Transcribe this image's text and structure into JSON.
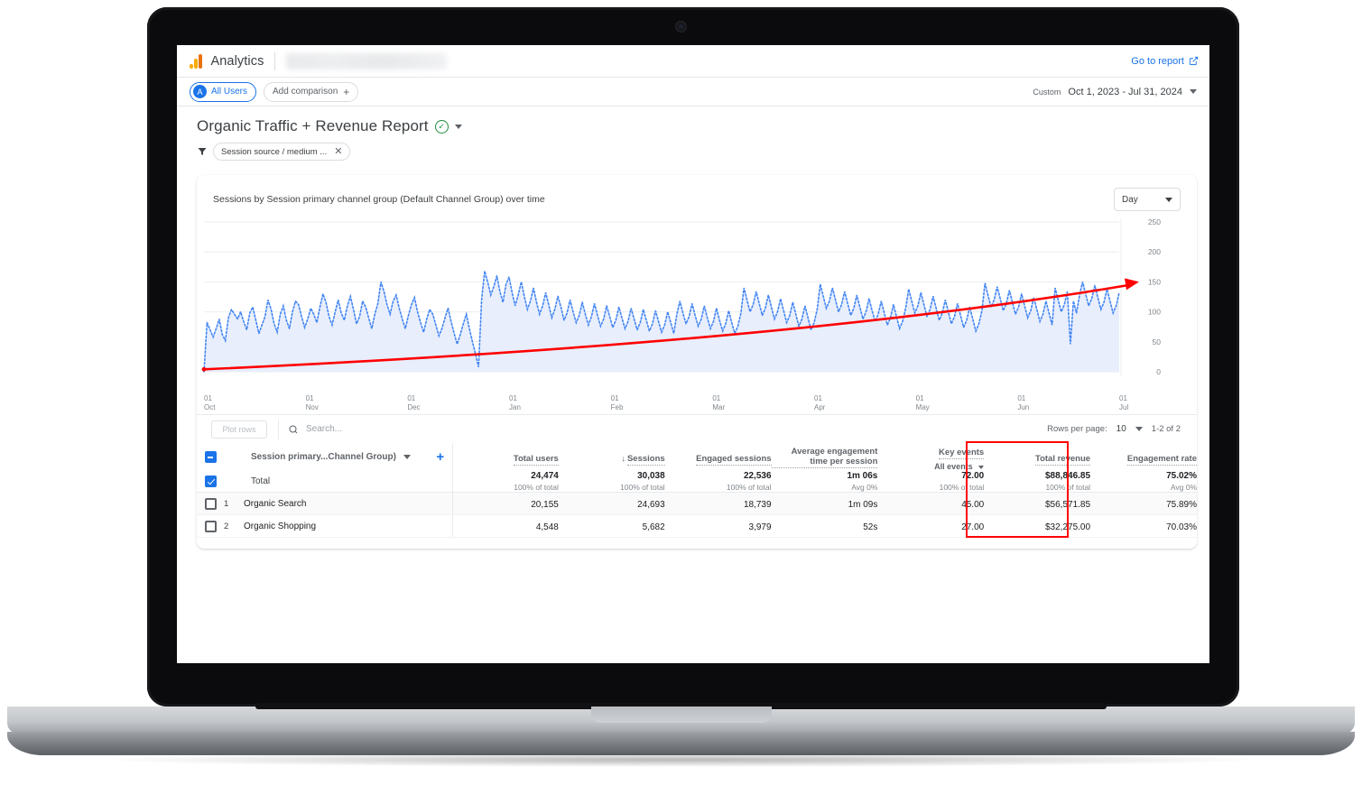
{
  "app": {
    "brand": "Analytics",
    "go_to_report": "Go to report",
    "logo_icon": "analytics-bars-icon",
    "external_link_icon": "external-link-icon"
  },
  "comparison_bar": {
    "all_users_chip": "All Users",
    "all_users_avatar": "A",
    "add_comparison": "Add comparison",
    "add_icon": "plus-icon",
    "custom_badge": "Custom",
    "date_range": "Oct 1, 2023 - Jul 31, 2024",
    "date_caret_icon": "chevron-down-icon"
  },
  "report": {
    "title": "Organic Traffic + Revenue Report",
    "status_icon": "check-circle-icon",
    "title_caret_icon": "chevron-down-icon",
    "filter_icon": "filter-icon",
    "filter_chip": "Session source / medium ...",
    "filter_remove_icon": "close-icon"
  },
  "chart_card": {
    "title": "Sessions by Session primary channel group (Default Channel Group) over time",
    "granularity": "Day",
    "granularity_caret_icon": "chevron-down-icon"
  },
  "chart_data": {
    "type": "line",
    "title": "Sessions by Session primary channel group (Default Channel Group) over time",
    "xlabel": "",
    "ylabel": "",
    "grid": true,
    "legend_position": "none",
    "ylim": [
      0,
      250
    ],
    "yticks": [
      0,
      50,
      100,
      150,
      200,
      250
    ],
    "xticks": [
      {
        "day": "01",
        "month": "Oct"
      },
      {
        "day": "01",
        "month": "Nov"
      },
      {
        "day": "01",
        "month": "Dec"
      },
      {
        "day": "01",
        "month": "Jan"
      },
      {
        "day": "01",
        "month": "Feb"
      },
      {
        "day": "01",
        "month": "Mar"
      },
      {
        "day": "01",
        "month": "Apr"
      },
      {
        "day": "01",
        "month": "May"
      },
      {
        "day": "01",
        "month": "Jun"
      },
      {
        "day": "01",
        "month": "Jul"
      }
    ],
    "series": [
      {
        "name": "Sessions",
        "style": "dotted-line-with-area-fill",
        "color": "#4285f4",
        "fill": "#e8eefc",
        "values": [
          0,
          82,
          70,
          58,
          72,
          88,
          62,
          52,
          90,
          104,
          96,
          88,
          100,
          84,
          70,
          98,
          108,
          86,
          64,
          78,
          92,
          120,
          104,
          80,
          66,
          96,
          110,
          86,
          72,
          100,
          118,
          112,
          92,
          74,
          88,
          106,
          96,
          82,
          108,
          130,
          116,
          92,
          78,
          100,
          120,
          98,
          86,
          110,
          126,
          104,
          80,
          92,
          118,
          108,
          90,
          72,
          96,
          114,
          150,
          134,
          112,
          96,
          118,
          128,
          106,
          88,
          72,
          94,
          112,
          124,
          100,
          82,
          66,
          88,
          104,
          96,
          78,
          60,
          72,
          90,
          106,
          84,
          64,
          46,
          62,
          80,
          96,
          72,
          50,
          30,
          8,
          120,
          168,
          150,
          128,
          142,
          160,
          134,
          116,
          146,
          158,
          132,
          110,
          128,
          150,
          126,
          104,
          118,
          140,
          116,
          96,
          110,
          132,
          112,
          90,
          104,
          126,
          108,
          86,
          98,
          120,
          100,
          82,
          94,
          116,
          96,
          78,
          92,
          114,
          94,
          76,
          88,
          110,
          92,
          74,
          86,
          108,
          90,
          72,
          84,
          106,
          88,
          70,
          82,
          104,
          86,
          68,
          80,
          102,
          84,
          66,
          78,
          100,
          82,
          64,
          96,
          118,
          98,
          80,
          92,
          114,
          94,
          76,
          88,
          110,
          90,
          72,
          84,
          106,
          86,
          68,
          80,
          102,
          82,
          64,
          76,
          98,
          140,
          120,
          100,
          112,
          134,
          114,
          94,
          106,
          128,
          108,
          88,
          100,
          122,
          102,
          82,
          94,
          116,
          96,
          76,
          88,
          110,
          90,
          70,
          82,
          104,
          146,
          126,
          106,
          118,
          140,
          120,
          100,
          112,
          134,
          114,
          94,
          106,
          128,
          108,
          88,
          100,
          122,
          102,
          84,
          96,
          118,
          98,
          78,
          90,
          112,
          92,
          72,
          84,
          106,
          138,
          118,
          98,
          110,
          132,
          112,
          92,
          104,
          126,
          106,
          86,
          98,
          120,
          100,
          80,
          92,
          114,
          94,
          74,
          86,
          108,
          88,
          68,
          80,
          102,
          148,
          128,
          108,
          120,
          142,
          122,
          102,
          114,
          136,
          116,
          96,
          108,
          130,
          110,
          90,
          102,
          124,
          104,
          84,
          96,
          118,
          98,
          78,
          140,
          120,
          100,
          112,
          134,
          46,
          118,
          98,
          128,
          150,
          130,
          110,
          122,
          144,
          124,
          104,
          116,
          138,
          118,
          98,
          110,
          132
        ]
      }
    ],
    "annotations": [
      {
        "type": "trend-arrow",
        "color": "#ff0000",
        "label": "upward trend arrow",
        "start_value": 4,
        "end_value": 150
      }
    ]
  },
  "table_toolbar": {
    "plot_rows": "Plot rows",
    "search_icon": "search-icon",
    "search_placeholder": "Search...",
    "rows_per_page_label": "Rows per page:",
    "rows_per_page_value": "10",
    "rows_per_page_caret_icon": "chevron-down-icon",
    "range": "1-2 of 2"
  },
  "table": {
    "dimension_header": "Session primary...Channel Group)",
    "dimension_caret_icon": "chevron-down-icon",
    "add_dimension_icon": "plus-icon",
    "sort_icon": "arrow-down-icon",
    "sorted_column": "Sessions",
    "columns": [
      {
        "label": "Total users",
        "sorted": false
      },
      {
        "label": "Sessions",
        "sorted": true
      },
      {
        "label": "Engaged sessions",
        "sorted": false
      },
      {
        "label": "Average engagement time per session",
        "sorted": false
      },
      {
        "label": "Key events",
        "sorted": false,
        "sub": "All events",
        "sub_caret_icon": "chevron-down-icon"
      },
      {
        "label": "Total revenue",
        "sorted": false
      },
      {
        "label": "Engagement rate",
        "sorted": false
      }
    ],
    "total_row": {
      "label": "Total",
      "checked": true,
      "values": [
        "24,474",
        "30,038",
        "22,536",
        "1m 06s",
        "72.00",
        "$88,846.85",
        "75.02%"
      ],
      "subs": [
        "100% of total",
        "100% of total",
        "100% of total",
        "Avg 0%",
        "100% of total",
        "100% of total",
        "Avg 0%"
      ]
    },
    "rows": [
      {
        "index": "1",
        "checked": false,
        "label": "Organic Search",
        "values": [
          "20,155",
          "24,693",
          "18,739",
          "1m 09s",
          "45.00",
          "$56,571.85",
          "75.89%"
        ]
      },
      {
        "index": "2",
        "checked": false,
        "label": "Organic Shopping",
        "values": [
          "4,548",
          "5,682",
          "3,979",
          "52s",
          "27.00",
          "$32,275.00",
          "70.03%"
        ]
      }
    ]
  },
  "colors": {
    "accent_blue": "#1a73e8",
    "chart_line": "#4285f4",
    "chart_fill": "#e8eefc",
    "highlight_red": "#ff0000",
    "brand_orange": "#f9ab00"
  }
}
